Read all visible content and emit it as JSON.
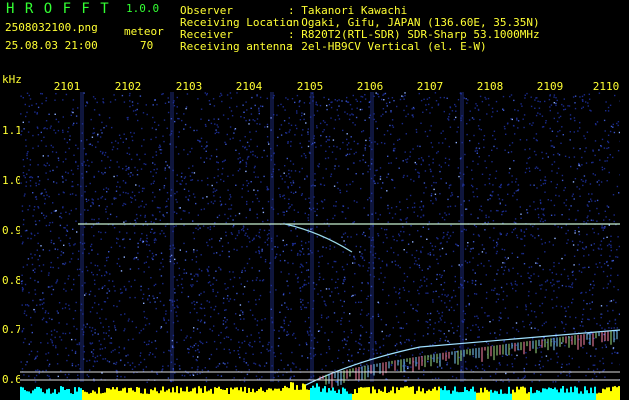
{
  "app": {
    "title": "H R O F F T",
    "version": "1.0.0"
  },
  "file": {
    "name": "2508032100.png",
    "datetime": "25.08.03 21:00"
  },
  "detection": {
    "label": "meteor",
    "count": "70"
  },
  "station": [
    {
      "key": "Observer",
      "value": ": Takanori Kawachi"
    },
    {
      "key": "Receiving Location",
      "value": ": Ogaki, Gifu, JAPAN (136.60E, 35.35N)"
    },
    {
      "key": "Receiver",
      "value": ": R820T2(RTL-SDR) SDR-Sharp 53.1000MHz"
    },
    {
      "key": "Receiving antenna",
      "value": ": 2el-HB9CV Vertical (el. E-W)"
    }
  ],
  "axes": {
    "y_unit": "kHz",
    "x_ticks": [
      "2101",
      "2102",
      "2103",
      "2104",
      "2105",
      "2106",
      "2107",
      "2108",
      "2109",
      "2110"
    ],
    "y_ticks": [
      "1.1",
      "1.0",
      "0.9",
      "0.8",
      "0.7",
      "0.6"
    ]
  },
  "colors": {
    "background": "#000000",
    "noise": "#1a2a8a",
    "carrier": "#c8f0d0",
    "label": "#ffff33",
    "brand": "#33ff33",
    "meter_yellow": "#ffff00",
    "meter_cyan": "#00ffff"
  }
}
